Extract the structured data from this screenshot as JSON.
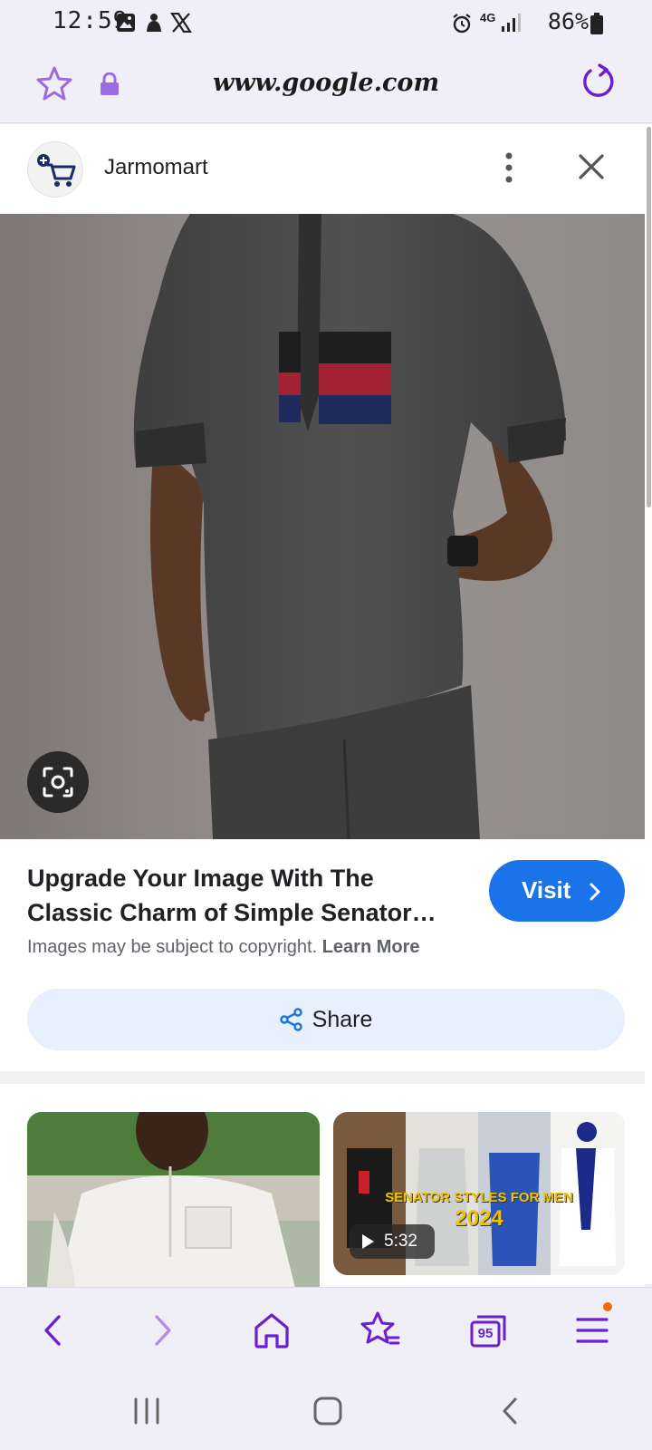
{
  "status_bar": {
    "time": "12:59",
    "battery": "86%",
    "network": "4G",
    "icons": [
      "gallery-icon",
      "notification-icon",
      "x-icon",
      "alarm-icon",
      "signal-icon",
      "battery-icon"
    ]
  },
  "url_bar": {
    "url": "www.google.com",
    "icons": [
      "star-icon",
      "lock-icon",
      "reload-icon"
    ]
  },
  "header": {
    "site_name": "Jarmomart",
    "icons": [
      "site-logo-cart-icon",
      "more-vert-icon",
      "close-icon"
    ]
  },
  "result": {
    "title": "Upgrade Your Image With The Classic Charm of Simple Senator…",
    "visit_label": "Visit",
    "copyright_text": "Images may be subject to copyright.",
    "learn_more": "Learn More",
    "share_label": "Share"
  },
  "related": {
    "video_caption": "SENATOR STYLES FOR MEN",
    "video_year": "2024",
    "video_duration": "5:32"
  },
  "toolbar": {
    "items": [
      "back-icon",
      "forward-icon",
      "home-icon",
      "bookmarks-icon",
      "tabs-icon",
      "menu-icon"
    ],
    "tab_count": "95"
  },
  "colors": {
    "accent": "#6a1fd1",
    "visit_button": "#1a73e8",
    "share_bg": "#e8effd",
    "chrome_bg": "#f0eef6",
    "notification_dot": "#f06a00"
  }
}
